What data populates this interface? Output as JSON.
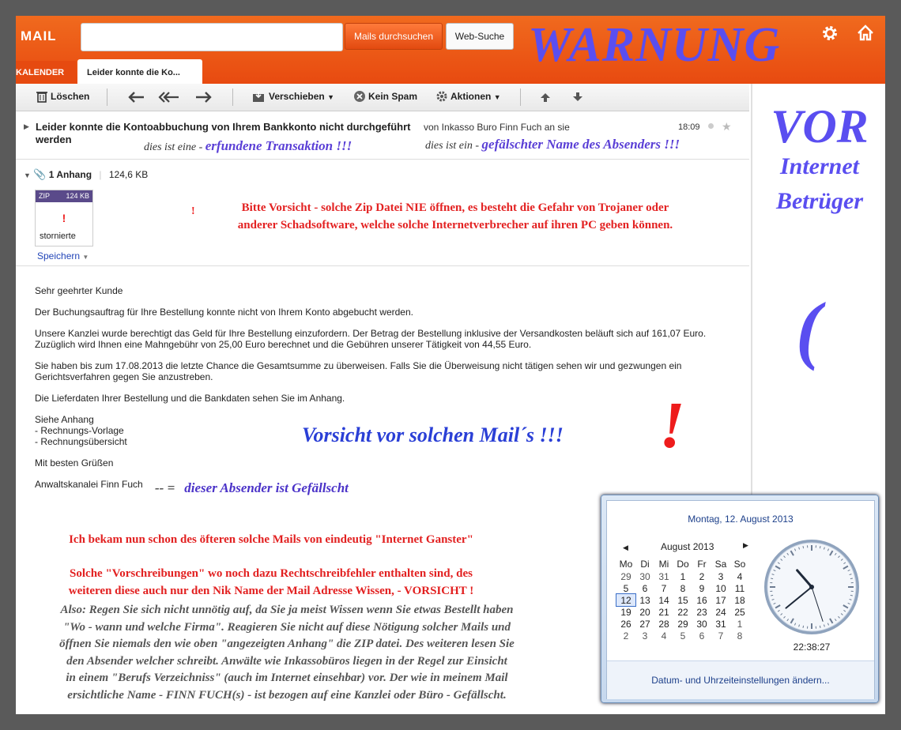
{
  "header": {
    "logo": "MAIL",
    "search_placeholder": "",
    "search_button": "Mails durchsuchen",
    "web_button": "Web-Suche",
    "warning_overlay": "WARNUNG"
  },
  "tabs": [
    {
      "label": "KALENDER"
    },
    {
      "label": "Leider konnte die Ko..."
    }
  ],
  "toolbar": {
    "delete": "Löschen",
    "move": "Verschieben",
    "spam": "Kein Spam",
    "actions": "Aktionen"
  },
  "message": {
    "subject": "Leider konnte die Kontoabbuchung von Ihrem Bankkonto nicht durchgeführt werden",
    "from": "von Inkasso Buro Finn Fuch an sie",
    "time": "18:09",
    "note_transaction_prefix": "dies ist eine -",
    "note_transaction": "erfundene Transaktion !!!",
    "note_sender_prefix": "dies ist ein -",
    "note_sender": "gefälschter Name des Absenders !!!",
    "attachment_count": "1 Anhang",
    "attachment_size": "124,6 KB",
    "zip_type": "ZIP",
    "zip_size": "124 KB",
    "zip_mark": "!",
    "zip_name": "stornierte",
    "save": "Speichern",
    "warning_mark": "!",
    "warning_line1": "Bitte Vorsicht - solche Zip Datei NIE öffnen, es besteht die Gefahr von Trojaner oder",
    "warning_line2": "anderer Schadsoftware, welche solche Internetverbrecher auf ihren PC geben können.",
    "body": {
      "greeting": "Sehr geehrter Kunde",
      "p1": "Der Buchungsauftrag für Ihre Bestellung konnte nicht von Ihrem Konto abgebucht werden.",
      "p2a": "Unsere Kanzlei wurde berechtigt das Geld für Ihre Bestellung einzufordern. Der Betrag der Bestellung inklusive der Versandkosten beläuft sich auf 161,07 Euro.",
      "p2b": "Zuzüglich wird Ihnen eine Mahngebühr von 25,00 Euro berechnet und die Gebühren unserer Tätigkeit von 44,55 Euro.",
      "p3a": "Sie haben bis zum 17.08.2013 die letzte Chance die Gesamtsumme zu überweisen. Falls Sie die Überweisung nicht tätigen sehen wir und gezwungen ein",
      "p3b": "Gerichtsverfahren gegen Sie anzustreben.",
      "p4": "Die Lieferdaten Ihrer Bestellung und die Bankdaten sehen Sie im Anhang.",
      "p5a": "Siehe Anhang",
      "p5b": "- Rechnungs-Vorlage",
      "p5c": "- Rechnungsübersicht",
      "p6": "Mit besten Grüßen",
      "p7": "Anwaltskanalei Finn Fuch"
    }
  },
  "annotations": {
    "vorsicht": "Vorsicht vor solchen Mail´s !!!",
    "big_exclaim": "!",
    "sender_arrow": "-- =",
    "sender_fake": "dieser Absender ist Gefällscht",
    "red_a": "Ich bekam nun schon des öfteren solche Mails von eindeutig \"Internet Ganster\"",
    "red_b1": "Solche \"Vorschreibungen\" wo noch dazu Rechtschreibfehler enthalten sind, des",
    "red_b2": "weiteren diese auch nur den Nik Name der Mail Adresse Wissen, - VORSICHT !",
    "also_lines": [
      "Also: Regen Sie sich nicht unnötig auf, da Sie ja meist Wissen wenn Sie etwas Bestellt haben",
      "\"Wo - wann und welche Firma\". Reagieren Sie nicht auf diese Nötigung solcher Mails und",
      "öffnen Sie niemals den wie oben \"angezeigten Anhang\" die ZIP datei. Des weiteren lesen Sie",
      "den Absender welcher schreibt. Anwälte wie Inkassobüros liegen in der Regel zur Einsicht",
      "in einem \"Berufs Verzeichniss\" (auch im Internet einsehbar) vor. Der wie in meinem Mail",
      "ersichtliche Name - FINN FUCH(s) - ist bezogen auf eine Kanzlei oder Büro - Gefällscht."
    ]
  },
  "sidebar": {
    "vor": "VOR",
    "internet": "Internet",
    "betrueger": "Betrüger",
    "paren": "("
  },
  "calendar": {
    "date_title": "Montag, 12. August 2013",
    "month": "August 2013",
    "prev": "◀",
    "next": "▶",
    "weekdays": [
      "Mo",
      "Di",
      "Mi",
      "Do",
      "Fr",
      "Sa",
      "So"
    ],
    "weeks": [
      [
        "29",
        "30",
        "31",
        "1",
        "2",
        "3",
        "4"
      ],
      [
        "5",
        "6",
        "7",
        "8",
        "9",
        "10",
        "11"
      ],
      [
        "12",
        "13",
        "14",
        "15",
        "16",
        "17",
        "18"
      ],
      [
        "19",
        "20",
        "21",
        "22",
        "23",
        "24",
        "25"
      ],
      [
        "26",
        "27",
        "28",
        "29",
        "30",
        "31",
        "1"
      ],
      [
        "2",
        "3",
        "4",
        "5",
        "6",
        "7",
        "8"
      ]
    ],
    "today": "12",
    "time": "22:38:27",
    "clock": {
      "hours": 22,
      "minutes": 38,
      "seconds": 27
    },
    "settings_link": "Datum- und Uhrzeiteinstellungen ändern..."
  },
  "colors": {
    "brand_orange": "#e84a10",
    "overlay_blue": "#5a4ef0",
    "warning_red": "#e32222"
  }
}
